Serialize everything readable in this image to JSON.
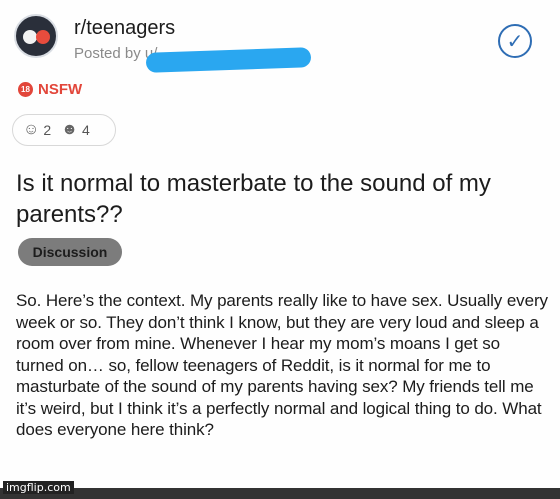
{
  "post": {
    "subreddit": "r/teenagers",
    "posted_by": "Posted by u/",
    "nsfw_badge": "18",
    "nsfw_label": "NSFW",
    "awards": [
      {
        "icon": "award-icon",
        "count": "2"
      },
      {
        "icon": "award-icon",
        "count": "4"
      }
    ],
    "title": "Is it normal to masterbate to the sound of my parents??",
    "flair": "Discussion",
    "body": "So. Here’s the context. My parents really like to have sex. Usually every week or so. They don’t think I know, but they are very loud and sleep a room over from mine. Whenever I hear my mom’s moans I get so turned on… so, fellow teenagers of Reddit, is it normal for me to masturbate of the sound of my parents having sex? My friends tell me it’s weird, but I think it’s a perfectly normal and logical thing to do. What does everyone here think?"
  },
  "watermark": "imgflip.com",
  "colors": {
    "nsfw": "#e2463a",
    "check": "#2e6db4",
    "redaction": "#2aa7f0",
    "flair_bg": "#7c7c7c"
  }
}
